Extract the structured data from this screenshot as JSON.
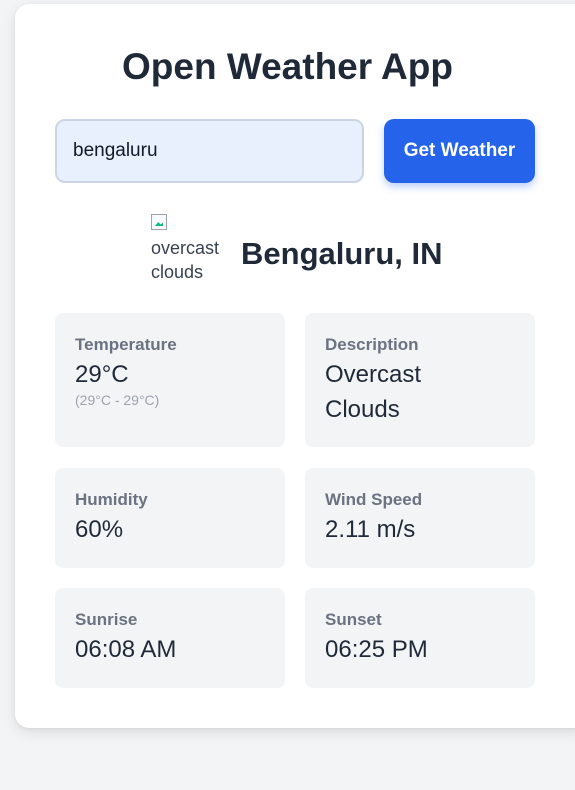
{
  "app": {
    "title": "Open Weather App"
  },
  "search": {
    "value": "bengaluru",
    "button_label": "Get Weather"
  },
  "location": {
    "icon_alt": "overcast clouds",
    "name": "Bengaluru, IN"
  },
  "details": {
    "temperature": {
      "label": "Temperature",
      "value": "29°C",
      "range": "(29°C - 29°C)"
    },
    "description": {
      "label": "Description",
      "value": "Overcast Clouds"
    },
    "humidity": {
      "label": "Humidity",
      "value": "60%"
    },
    "wind_speed": {
      "label": "Wind Speed",
      "value": "2.11 m/s"
    },
    "sunrise": {
      "label": "Sunrise",
      "value": "06:08 AM"
    },
    "sunset": {
      "label": "Sunset",
      "value": "06:25 PM"
    }
  },
  "colors": {
    "accent": "#2563eb",
    "tile_bg": "#f3f4f6",
    "input_bg": "#e8f0fe"
  }
}
